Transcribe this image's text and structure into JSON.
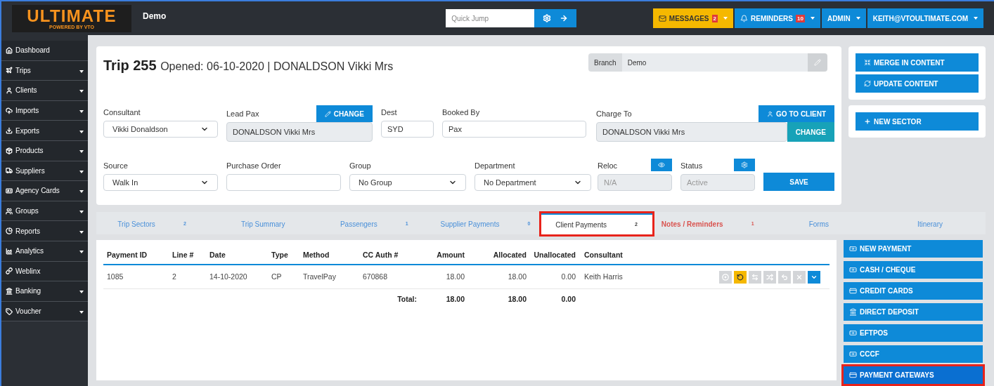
{
  "header": {
    "logo": {
      "title": "ULTIMATE",
      "subtitle": "POWERED BY VTO"
    },
    "workspace": "Demo",
    "quick_jump": {
      "placeholder": "Quick Jump"
    },
    "nav": [
      {
        "label": "MESSAGES",
        "badge": "2",
        "kind": "warning"
      },
      {
        "label": "REMINDERS",
        "badge": "10",
        "kind": "primary"
      },
      {
        "label": "ADMIN",
        "kind": "primary"
      },
      {
        "label": "KEITH@VTOULTIMATE.COM",
        "kind": "primary"
      }
    ]
  },
  "sidebar": {
    "items": [
      {
        "label": "Dashboard",
        "has_caret": false
      },
      {
        "label": "Trips",
        "has_caret": true
      },
      {
        "label": "Clients",
        "has_caret": true
      },
      {
        "label": "Imports",
        "has_caret": true
      },
      {
        "label": "Exports",
        "has_caret": true
      },
      {
        "label": "Products",
        "has_caret": true
      },
      {
        "label": "Suppliers",
        "has_caret": true
      },
      {
        "label": "Agency Cards",
        "has_caret": true
      },
      {
        "label": "Groups",
        "has_caret": true
      },
      {
        "label": "Reports",
        "has_caret": true
      },
      {
        "label": "Analytics",
        "has_caret": true
      },
      {
        "label": "Weblinx",
        "has_caret": false
      },
      {
        "label": "Banking",
        "has_caret": true
      },
      {
        "label": "Voucher",
        "has_caret": true
      }
    ]
  },
  "trip": {
    "title": "Trip 255",
    "subtitle": "Opened: 06-10-2020 | DONALDSON Vikki Mrs",
    "branch": {
      "label": "Branch",
      "value": "Demo"
    },
    "consultant": {
      "label": "Consultant",
      "value": "Vikki Donaldson"
    },
    "lead_pax": {
      "label": "Lead Pax",
      "value": "DONALDSON Vikki Mrs",
      "button": "CHANGE"
    },
    "dest": {
      "label": "Dest",
      "value": "SYD"
    },
    "booked_by": {
      "label": "Booked By",
      "value": "Pax"
    },
    "charge_to": {
      "label": "Charge To",
      "value": "DONALDSON Vikki Mrs",
      "go_button": "GO TO CLIENT",
      "change_button": "CHANGE"
    },
    "source": {
      "label": "Source",
      "value": "Walk In"
    },
    "purchase_order": {
      "label": "Purchase Order"
    },
    "group": {
      "label": "Group",
      "value": "No Group"
    },
    "department": {
      "label": "Department",
      "value": "No Department"
    },
    "reloc": {
      "label": "Reloc",
      "placeholder": "N/A"
    },
    "status": {
      "label": "Status",
      "placeholder": "Active"
    },
    "save_button": "SAVE"
  },
  "content_panel": {
    "buttons": [
      "MERGE IN CONTENT",
      "UPDATE CONTENT"
    ],
    "new_sector": "NEW SECTOR"
  },
  "tabs": [
    {
      "label": "Trip Sectors",
      "count": "2",
      "selected": false,
      "highlighted": false,
      "kind": "normal"
    },
    {
      "label": "Trip Summary",
      "selected": false,
      "highlighted": false,
      "kind": "normal"
    },
    {
      "label": "Passengers",
      "count": "1",
      "selected": false,
      "highlighted": false,
      "kind": "normal"
    },
    {
      "label": "Supplier Payments",
      "count": "0",
      "selected": false,
      "highlighted": false,
      "kind": "normal"
    },
    {
      "label": "Client Payments",
      "count": "2",
      "selected": true,
      "highlighted": true,
      "kind": "normal"
    },
    {
      "label": "Notes / Reminders",
      "count": "1",
      "selected": false,
      "highlighted": false,
      "kind": "alert"
    },
    {
      "label": "Forms",
      "selected": false,
      "highlighted": false,
      "kind": "normal"
    },
    {
      "label": "Itinerary",
      "selected": false,
      "highlighted": false,
      "kind": "normal"
    }
  ],
  "table": {
    "columns": [
      "Payment ID",
      "Line #",
      "Date",
      "Type",
      "Method",
      "CC Auth #",
      "Amount",
      "Allocated",
      "Unallocated",
      "Consultant"
    ],
    "rows": [
      {
        "cells": [
          "1085",
          "2",
          "14-10-2020",
          "CP",
          "TravelPay",
          "670868",
          "18.00",
          "18.00",
          "0.00",
          "Keith Harris"
        ],
        "actions": [
          {
            "kind": "disabled"
          },
          {
            "kind": "warning"
          },
          {
            "kind": "disabled"
          },
          {
            "kind": "disabled"
          },
          {
            "kind": "disabled"
          },
          {
            "kind": "disabled"
          },
          {
            "kind": "primary"
          }
        ]
      }
    ],
    "total": {
      "label": "Total:",
      "amount": "18.00",
      "allocated": "18.00",
      "unallocated": "0.00"
    }
  },
  "payment_buttons": [
    {
      "label": "NEW PAYMENT",
      "selected": false,
      "highlighted": false
    },
    {
      "label": "CASH / CHEQUE",
      "selected": false,
      "highlighted": false
    },
    {
      "label": "CREDIT CARDS",
      "selected": false,
      "highlighted": false
    },
    {
      "label": "DIRECT DEPOSIT",
      "selected": false,
      "highlighted": false
    },
    {
      "label": "EFTPOS",
      "selected": false,
      "highlighted": false
    },
    {
      "label": "CCCF",
      "selected": false,
      "highlighted": false
    },
    {
      "label": "PAYMENT GATEWAYS",
      "selected": true,
      "highlighted": true
    }
  ]
}
